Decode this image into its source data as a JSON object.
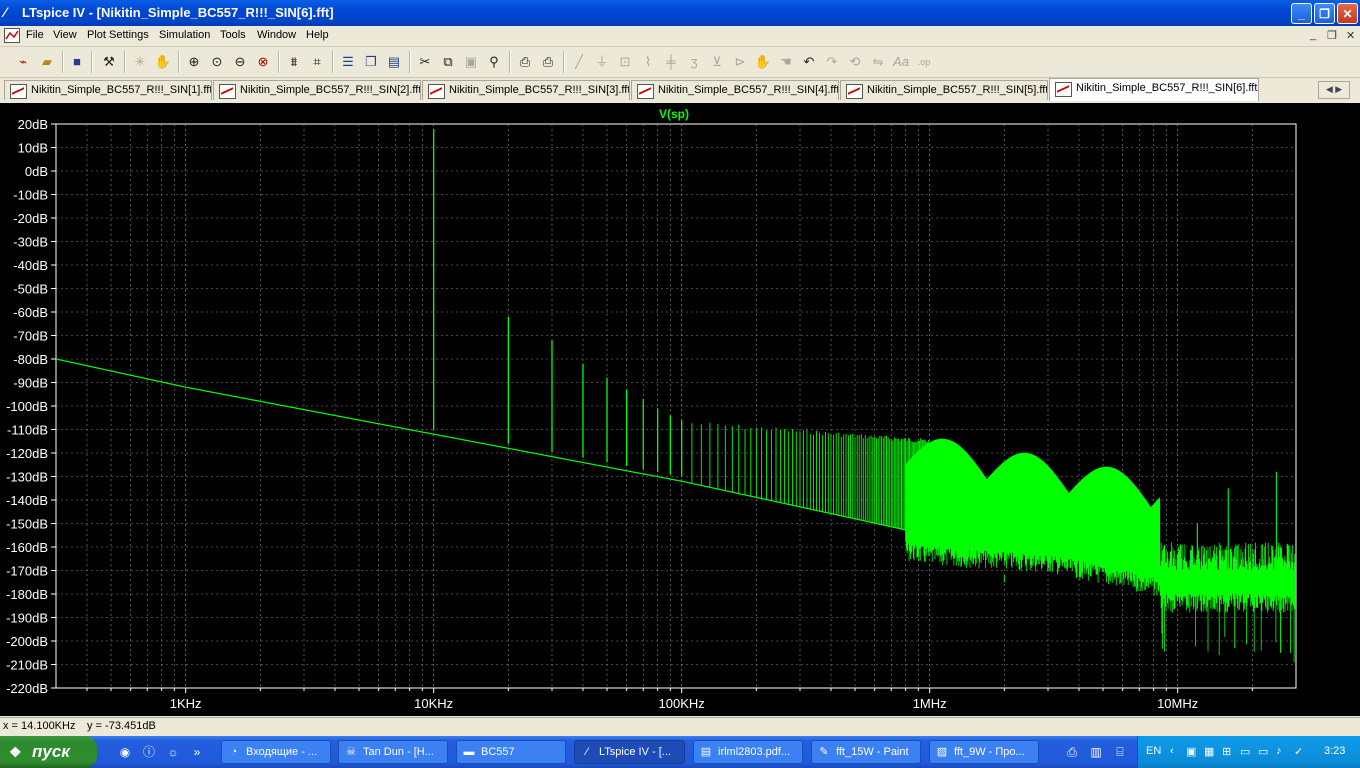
{
  "window": {
    "title": "LTspice IV - [Nikitin_Simple_BC557_R!!!_SIN[6].fft]",
    "controls": [
      "_",
      "❐",
      "✕"
    ]
  },
  "menu": [
    {
      "label": "File"
    },
    {
      "label": "View"
    },
    {
      "label": "Plot Settings"
    },
    {
      "label": "Simulation"
    },
    {
      "label": "Tools"
    },
    {
      "label": "Window"
    },
    {
      "label": "Help"
    }
  ],
  "mdi_controls": [
    "_",
    "❐",
    "✕"
  ],
  "toolbar": [
    "new-schematic-icon",
    "open-icon",
    "save-icon",
    "control-panel-icon",
    "run-icon",
    "halt-icon",
    "zoom-area-icon",
    "pan-icon",
    "zoom-out-icon",
    "zoom-fit-icon",
    "autorange-icon",
    "plot-pane-icon",
    "tile-vertical-icon",
    "cascade-icon",
    "tile-horizontal-icon",
    "cut-icon",
    "copy-icon",
    "paste-icon",
    "find-icon",
    "print-setup-icon",
    "print-icon",
    "wire-icon",
    "ground-icon",
    "label-icon",
    "resistor-icon",
    "capacitor-icon",
    "inductor-icon",
    "diode-icon",
    "component-icon",
    "move-icon",
    "drag-icon",
    "undo-icon",
    "redo-icon",
    "rotate-icon",
    "mirror-icon",
    "text-icon",
    "spice-directive-icon"
  ],
  "tabs": [
    {
      "label": "Nikitin_Simple_BC557_R!!!_SIN[1].fft",
      "active": false
    },
    {
      "label": "Nikitin_Simple_BC557_R!!!_SIN[2].fft",
      "active": false
    },
    {
      "label": "Nikitin_Simple_BC557_R!!!_SIN[3].fft",
      "active": false
    },
    {
      "label": "Nikitin_Simple_BC557_R!!!_SIN[4].fft",
      "active": false
    },
    {
      "label": "Nikitin_Simple_BC557_R!!!_SIN[5].fft",
      "active": false
    },
    {
      "label": "Nikitin_Simple_BC557_R!!!_SIN[6].fft",
      "active": true
    }
  ],
  "plot": {
    "trace_name": "V(sp)",
    "trace_color": "#00FF00",
    "y_ticks": [
      "20dB",
      "10dB",
      "0dB",
      "-10dB",
      "-20dB",
      "-30dB",
      "-40dB",
      "-50dB",
      "-60dB",
      "-70dB",
      "-80dB",
      "-90dB",
      "-100dB",
      "-110dB",
      "-120dB",
      "-130dB",
      "-140dB",
      "-150dB",
      "-160dB",
      "-170dB",
      "-180dB",
      "-190dB",
      "-200dB",
      "-210dB",
      "-220dB"
    ],
    "x_ticks": [
      "1KHz",
      "10KHz",
      "100KHz",
      "1MHz",
      "10MHz"
    ],
    "x_scale": "log",
    "x_range_hz": [
      300,
      30000000
    ],
    "y_range_db": [
      -220,
      20
    ]
  },
  "chart_data": {
    "type": "line",
    "title": "V(sp)",
    "x_scale": "log",
    "xlim": [
      300,
      30000000
    ],
    "ylim": [
      -220,
      20
    ],
    "grid": true,
    "series": [
      {
        "name": "V(sp)",
        "noise_floor": {
          "x": [
            300,
            1000,
            10000,
            100000,
            500000,
            1000000,
            3000000,
            10000000,
            30000000
          ],
          "y": [
            -80,
            -92,
            -112,
            -132,
            -148,
            -155,
            -158,
            -170,
            -180
          ]
        },
        "harmonics": {
          "x": [
            10000,
            20000,
            30000,
            40000,
            50000,
            60000,
            70000,
            80000,
            90000,
            100000
          ],
          "y": [
            18,
            -62,
            -72,
            -82,
            -88,
            -93,
            -97,
            -101,
            -104,
            -106
          ]
        }
      }
    ]
  },
  "status": {
    "x_readout": "x = 14.100KHz",
    "y_readout": "y = -73.451dB"
  },
  "taskbar": {
    "start_label": "пуск",
    "tasks": [
      {
        "label": "Входящие - ...",
        "icon": "firefox-icon",
        "active": false
      },
      {
        "label": "Tan Dun - [H...",
        "icon": "winamp-icon",
        "active": false
      },
      {
        "label": "BC557",
        "icon": "folder-icon",
        "active": false
      },
      {
        "label": "LTspice IV - [...",
        "icon": "ltspice-icon",
        "active": true
      },
      {
        "label": "irlml2803.pdf...",
        "icon": "pdf-icon",
        "active": false
      },
      {
        "label": "fft_15W - Paint",
        "icon": "paint-icon",
        "active": false
      },
      {
        "label": "fft_9W - Про...",
        "icon": "image-viewer-icon",
        "active": false
      }
    ],
    "language": "EN",
    "clock": "3:23"
  }
}
